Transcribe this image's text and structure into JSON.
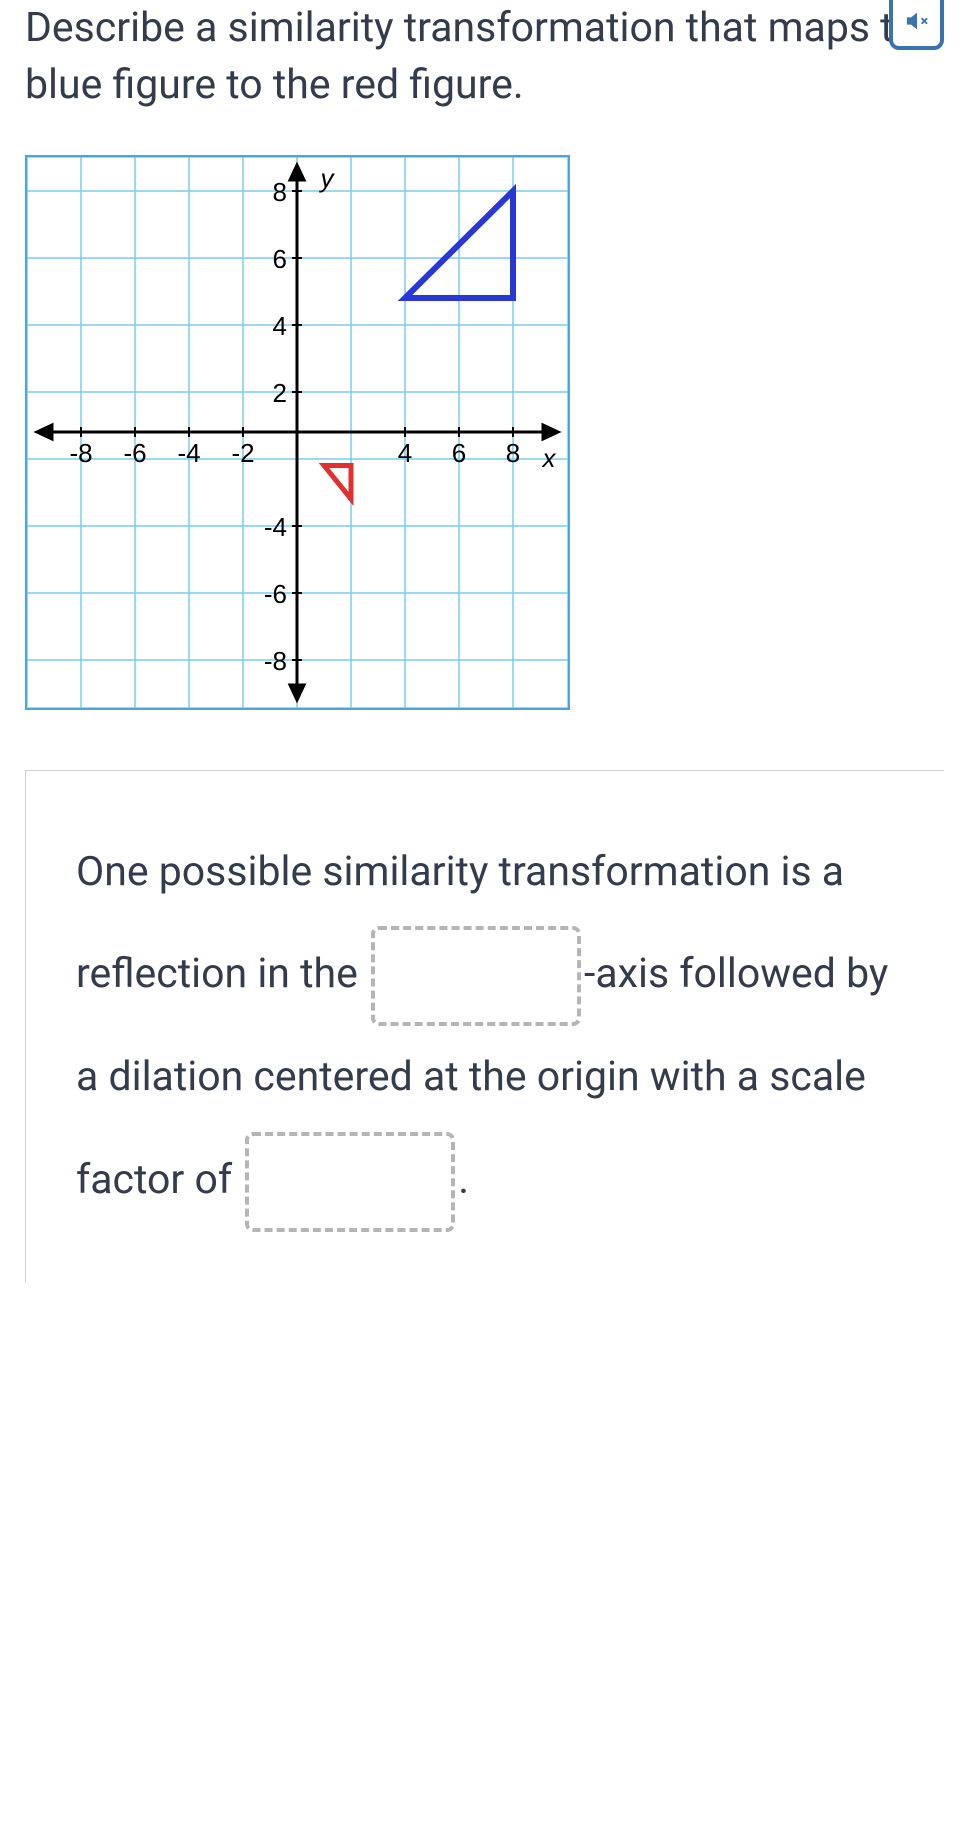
{
  "question": "Describe a similarity transformation that maps the blue figure to the red figure.",
  "answer": {
    "part1": "One possible similarity transformation is a reflection in the ",
    "part2": "-axis followed by a dilation centered at the origin with a scale factor of ",
    "part3": "."
  },
  "chart_data": {
    "type": "coordinate_grid",
    "x_axis": {
      "min": -9,
      "max": 9,
      "ticks": [
        -8,
        -6,
        -4,
        -2,
        4,
        6,
        8
      ],
      "label": "x"
    },
    "y_axis": {
      "min": -9,
      "max": 9,
      "ticks": [
        8,
        6,
        4,
        2,
        -4,
        -6,
        -8
      ],
      "label": "y"
    },
    "shapes": [
      {
        "name": "blue_triangle",
        "color": "#2838d8",
        "vertices": [
          [
            4,
            4
          ],
          [
            8,
            4
          ],
          [
            8,
            8
          ]
        ],
        "fill": "none"
      },
      {
        "name": "red_triangle",
        "color": "#e03030",
        "vertices": [
          [
            1,
            -1
          ],
          [
            2,
            -1
          ],
          [
            2,
            -2
          ]
        ],
        "fill": "none"
      }
    ]
  },
  "icons": {
    "mute": "mute-icon"
  }
}
